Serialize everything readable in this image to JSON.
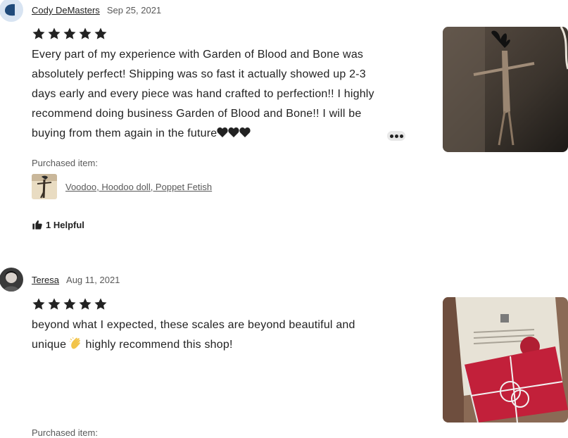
{
  "reviews": [
    {
      "reviewer": "Cody DeMasters",
      "date": "Sep 25, 2021",
      "rating": 5,
      "text": "Every part of my experience with Garden of Blood and Bone was absolutely perfect! Shipping was so fast it actually showed up 2-3 days early and every piece was hand crafted to perfection!! I highly recommend doing business Garden of Blood and Bone!! I will be buying from them again in the future",
      "emoji": "black-hearts",
      "purchased_label": "Purchased item:",
      "item_name": "Voodoo, Hoodoo doll, Poppet Fetish",
      "helpful": "1 Helpful",
      "more_icon": "ellipsis-icon"
    },
    {
      "reviewer": "Teresa",
      "date": "Aug 11, 2021",
      "rating": 5,
      "text_before": "beyond what I expected, these scales are beyond beautiful and unique ",
      "emoji": "clapping-hands",
      "text_after": " highly recommend this shop!",
      "purchased_label": "Purchased item:"
    }
  ],
  "colors": {
    "text": "#222222",
    "muted": "#595959",
    "star": "#222222"
  }
}
